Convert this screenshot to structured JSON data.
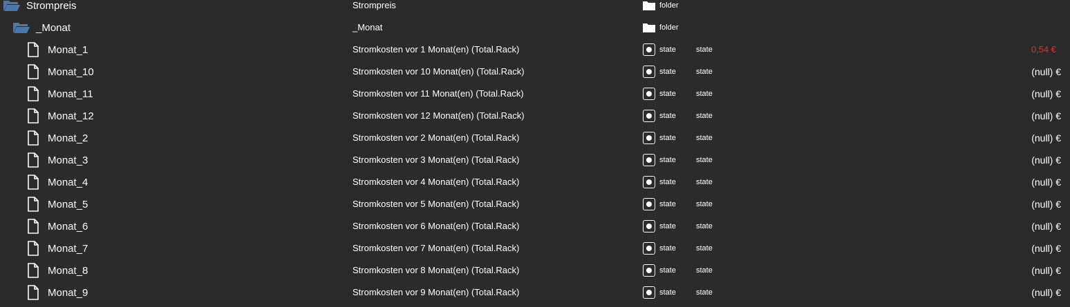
{
  "colors": {
    "background": "#2b2b2b",
    "folder_icon": "#4a78b0",
    "value_highlight": "#d9302b"
  },
  "rows": [
    {
      "name": "Strompreis",
      "description": "Strompreis",
      "type": "folder",
      "role": "",
      "value": "",
      "icon": "folder-open-icon"
    },
    {
      "name": "_Monat",
      "description": "_Monat",
      "type": "folder",
      "role": "",
      "value": "",
      "icon": "folder-open-icon"
    },
    {
      "name": "Monat_1",
      "description": "Stromkosten vor 1 Monat(en) (Total.Rack)",
      "type": "state",
      "role": "state",
      "value": "0,54 €",
      "icon": "file-icon"
    },
    {
      "name": "Monat_10",
      "description": "Stromkosten vor 10 Monat(en) (Total.Rack)",
      "type": "state",
      "role": "state",
      "value": "(null) €",
      "icon": "file-icon"
    },
    {
      "name": "Monat_11",
      "description": "Stromkosten vor 11 Monat(en) (Total.Rack)",
      "type": "state",
      "role": "state",
      "value": "(null) €",
      "icon": "file-icon"
    },
    {
      "name": "Monat_12",
      "description": "Stromkosten vor 12 Monat(en) (Total.Rack)",
      "type": "state",
      "role": "state",
      "value": "(null) €",
      "icon": "file-icon"
    },
    {
      "name": "Monat_2",
      "description": "Stromkosten vor 2 Monat(en) (Total.Rack)",
      "type": "state",
      "role": "state",
      "value": "(null) €",
      "icon": "file-icon"
    },
    {
      "name": "Monat_3",
      "description": "Stromkosten vor 3 Monat(en) (Total.Rack)",
      "type": "state",
      "role": "state",
      "value": "(null) €",
      "icon": "file-icon"
    },
    {
      "name": "Monat_4",
      "description": "Stromkosten vor 4 Monat(en) (Total.Rack)",
      "type": "state",
      "role": "state",
      "value": "(null) €",
      "icon": "file-icon"
    },
    {
      "name": "Monat_5",
      "description": "Stromkosten vor 5 Monat(en) (Total.Rack)",
      "type": "state",
      "role": "state",
      "value": "(null) €",
      "icon": "file-icon"
    },
    {
      "name": "Monat_6",
      "description": "Stromkosten vor 6 Monat(en) (Total.Rack)",
      "type": "state",
      "role": "state",
      "value": "(null) €",
      "icon": "file-icon"
    },
    {
      "name": "Monat_7",
      "description": "Stromkosten vor 7 Monat(en) (Total.Rack)",
      "type": "state",
      "role": "state",
      "value": "(null) €",
      "icon": "file-icon"
    },
    {
      "name": "Monat_8",
      "description": "Stromkosten vor 8 Monat(en) (Total.Rack)",
      "type": "state",
      "role": "state",
      "value": "(null) €",
      "icon": "file-icon"
    },
    {
      "name": "Monat_9",
      "description": "Stromkosten vor 9 Monat(en) (Total.Rack)",
      "type": "state",
      "role": "state",
      "value": "(null) €",
      "icon": "file-icon"
    }
  ]
}
